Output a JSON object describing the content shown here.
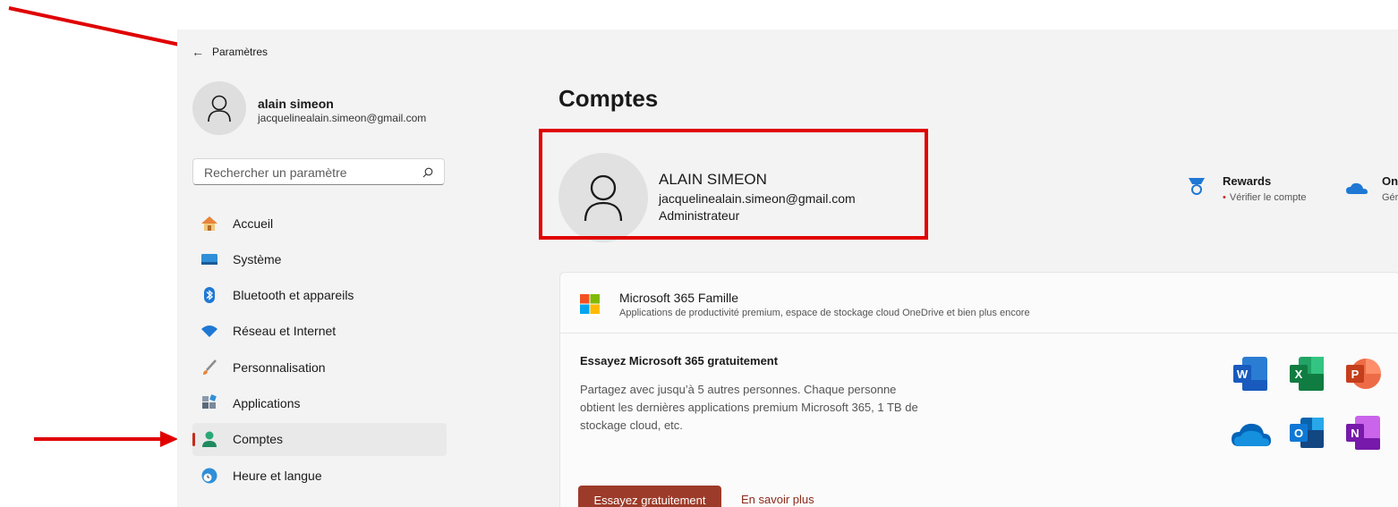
{
  "window": {
    "title": "Paramètres",
    "back_icon": "back-arrow-icon"
  },
  "profile": {
    "name": "alain simeon",
    "email": "jacquelinealain.simeon@gmail.com"
  },
  "search": {
    "placeholder": "Rechercher un paramètre"
  },
  "nav": {
    "items": [
      {
        "label": "Accueil",
        "icon": "home-icon"
      },
      {
        "label": "Système",
        "icon": "system-icon"
      },
      {
        "label": "Bluetooth et appareils",
        "icon": "bluetooth-icon"
      },
      {
        "label": "Réseau et Internet",
        "icon": "wifi-icon"
      },
      {
        "label": "Personnalisation",
        "icon": "brush-icon"
      },
      {
        "label": "Applications",
        "icon": "apps-icon"
      },
      {
        "label": "Comptes",
        "icon": "accounts-icon",
        "active": true
      },
      {
        "label": "Heure et langue",
        "icon": "time-language-icon"
      }
    ]
  },
  "page": {
    "heading": "Comptes"
  },
  "account": {
    "name": "ALAIN SIMEON",
    "email": "jacquelinealain.simeon@gmail.com",
    "role": "Administrateur"
  },
  "rewards": {
    "title": "Rewards",
    "subtitle": "Vérifier le compte"
  },
  "onedrive": {
    "title": "On",
    "subtitle": "Gér"
  },
  "m365": {
    "title": "Microsoft 365 Famille",
    "description": "Applications de productivité premium, espace de stockage cloud OneDrive et bien plus encore",
    "try_title": "Essayez Microsoft 365 gratuitement",
    "try_description": "Partagez avec jusqu’à 5 autres personnes. Chaque personne obtient les dernières applications premium Microsoft 365, 1 TB de stockage cloud, etc.",
    "try_button": "Essayez gratuitement",
    "learn_more": "En savoir plus",
    "app_icons": [
      "word-icon",
      "excel-icon",
      "powerpoint-icon",
      "onedrive-icon",
      "outlook-icon",
      "onenote-icon"
    ]
  },
  "colors": {
    "accent": "#9d3b2a",
    "annotation_red": "#e00000",
    "nav_indicator": "#c42b1c"
  }
}
